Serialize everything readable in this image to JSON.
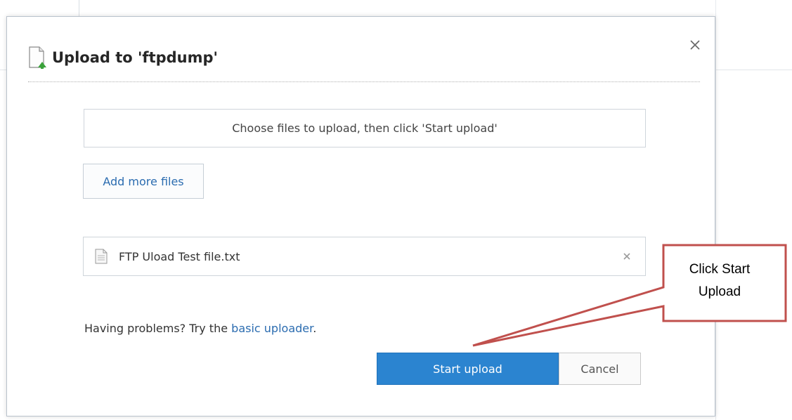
{
  "dialog": {
    "title": "Upload to 'ftpdump'",
    "close_icon": "close-icon",
    "title_icon": "document-upload-icon"
  },
  "dropzone": {
    "text": "Choose files to upload, then click 'Start upload'"
  },
  "add_files": {
    "label": "Add more files"
  },
  "file": {
    "name": "FTP Uload Test file.txt",
    "icon": "text-file-icon",
    "remove_icon": "remove-icon"
  },
  "help": {
    "prefix": "Having problems? Try the ",
    "link": "basic uploader",
    "suffix": "."
  },
  "buttons": {
    "start": "Start upload",
    "cancel": "Cancel"
  },
  "callout": {
    "line1": "Click Start",
    "line2": "Upload",
    "border_color": "#c0504d"
  },
  "colors": {
    "accent": "#2b84d0",
    "link": "#2b6cb0"
  }
}
